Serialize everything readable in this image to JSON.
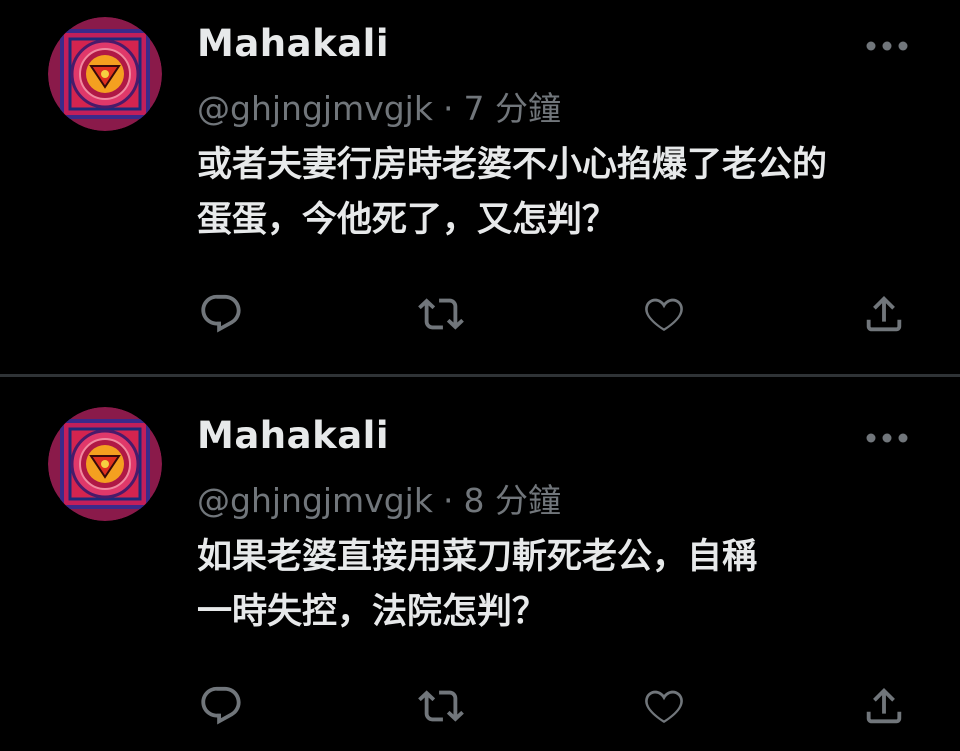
{
  "colors": {
    "background": "#000000",
    "text": "#e7e9ea",
    "secondary": "#71767b",
    "divider": "#2f3336"
  },
  "tweets": [
    {
      "author_name": "Mahakali",
      "handle": "@ghjngjmvgjk",
      "separator": "·",
      "time": "7 分鐘",
      "text_lines": [
        "或者夫妻行房時老婆不小心掐爆了老公的",
        "蛋蛋，今他死了，又怎判？"
      ],
      "icons": [
        "more-icon",
        "reply-icon",
        "retweet-icon",
        "like-icon",
        "share-icon"
      ]
    },
    {
      "author_name": "Mahakali",
      "handle": "@ghjngjmvgjk",
      "separator": "·",
      "time": "8 分鐘",
      "text_lines": [
        "如果老婆直接用菜刀斬死老公，自稱",
        "一時失控，法院怎判？"
      ],
      "icons": [
        "more-icon",
        "reply-icon",
        "retweet-icon",
        "like-icon",
        "share-icon"
      ]
    }
  ]
}
